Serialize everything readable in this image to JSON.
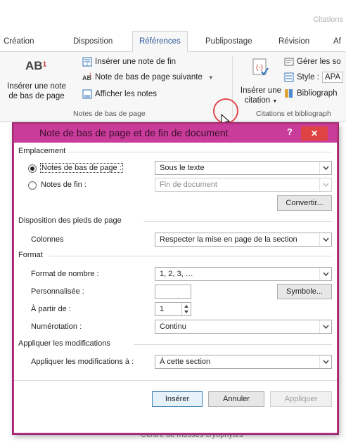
{
  "app": {
    "title": "Citations"
  },
  "tabs": [
    "Création",
    "Disposition",
    "Références",
    "Publipostage",
    "Révision",
    "Af"
  ],
  "ribbon": {
    "insert_footnote": "Insérer une note de bas de page",
    "insert_footnote_line1": "Insérer une note",
    "insert_footnote_line2": "de bas de page",
    "ab_glyph": "AB",
    "ab_sup": "1",
    "insert_endnote": "Insérer une note de fin",
    "next_footnote": "Note de bas de page suivante",
    "show_notes": "Afficher les notes",
    "group_notes": "Notes de bas de page",
    "insert_citation_line1": "Insérer une",
    "insert_citation_line2": "citation",
    "manage_sources": "Gérer les so",
    "style_label": "Style :",
    "style_value": "APA",
    "bibliography": "Bibliograph",
    "group_citations": "Citations et bibliograph"
  },
  "dialog": {
    "title": "Note de bas de page et de fin de document",
    "help": "?",
    "close": "✕",
    "placement": {
      "heading": "Emplacement",
      "footnotes_label": "Notes de bas de page :",
      "footnotes_value": "Sous le texte",
      "endnotes_label": "Notes de fin :",
      "endnotes_value": "Fin de document",
      "convert": "Convertir..."
    },
    "layout": {
      "heading": "Disposition des pieds de page",
      "columns_label": "Colonnes",
      "columns_value": "Respecter la mise en page de la section"
    },
    "format": {
      "heading": "Format",
      "number_format_label": "Format de nombre :",
      "number_format_value": "1, 2, 3, …",
      "custom_label": "Personnalisée :",
      "custom_value": "",
      "symbol": "Symbole...",
      "start_at_label": "À partir de :",
      "start_at_value": "1",
      "numbering_label": "Numérotation :",
      "numbering_value": "Continu"
    },
    "apply": {
      "heading": "Appliquer les modifications",
      "apply_to_label": "Appliquer les modifications à :",
      "apply_to_value": "À cette section"
    },
    "buttons": {
      "insert": "Insérer",
      "cancel": "Annuler",
      "apply": "Appliquer"
    }
  },
  "document": {
    "partial_text": "Centre de mosses cryophytes"
  },
  "colors": {
    "dialog_border": "#b5317f",
    "dialog_titlebar": "#c93c9a",
    "close": "#e04343",
    "accent": "#2b579a"
  }
}
